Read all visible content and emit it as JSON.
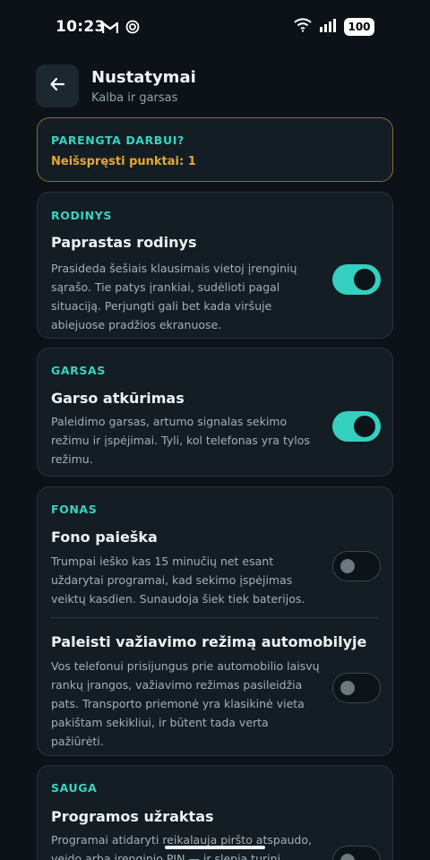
{
  "status_bar": {
    "time": "10:23",
    "battery": "100",
    "left_icons": [
      "gmail-icon",
      "sync-icon"
    ],
    "right_icons": [
      "wifi-icon",
      "signal-icon",
      "battery-icon"
    ]
  },
  "header": {
    "title": "Nustatymai",
    "subtitle": "Kalba ir garsas"
  },
  "ready": {
    "title": "PARENGTA DARBUI?",
    "text": "Neišspręsti punktai: 1"
  },
  "sections": {
    "view": {
      "label": "RODINYS",
      "items": [
        {
          "title": "Paprastas rodinys",
          "desc": "Prasideda šešiais klausimais vietoj įrenginių sąrašo. Tie patys įrankiai, sudėlioti pagal situaciją. Perjungti gali bet kada viršuje abiejuose pradžios ekranuose.",
          "on": true
        }
      ]
    },
    "sound": {
      "label": "GARSAS",
      "items": [
        {
          "title": "Garso atkūrimas",
          "desc": "Paleidimo garsas, artumo signalas sekimo režimu ir įspėjimai. Tyli, kol telefonas yra tylos režimu.",
          "on": true
        }
      ]
    },
    "background": {
      "label": "FONAS",
      "items": [
        {
          "title": "Fono paieška",
          "desc": "Trumpai ieško kas 15 minučių net esant uždarytai programai, kad sekimo įspėjimas veiktų kasdien. Sunaudoja šiek tiek baterijos.",
          "on": false
        },
        {
          "title": "Paleisti važiavimo režimą automobilyje",
          "desc": "Vos telefonui prisijungus prie automobilio laisvų rankų įrangos, važiavimo režimas pasileidžia pats. Transporto priemonė yra klasikinė vieta pakištam sekikliui, ir būtent tada verta pažiūrėti.",
          "on": false
        }
      ]
    },
    "security": {
      "label": "SAUGA",
      "items": [
        {
          "title": "Programos užraktas",
          "desc": "Programai atidaryti reikalauja piršto atspaudo, veido arba įrenginio PIN — ir slepia turinį",
          "on": false
        }
      ]
    }
  },
  "colors": {
    "background": "#0c1217",
    "card": "#141d24",
    "accent": "#35cfc0",
    "warning": "#e7a832"
  }
}
